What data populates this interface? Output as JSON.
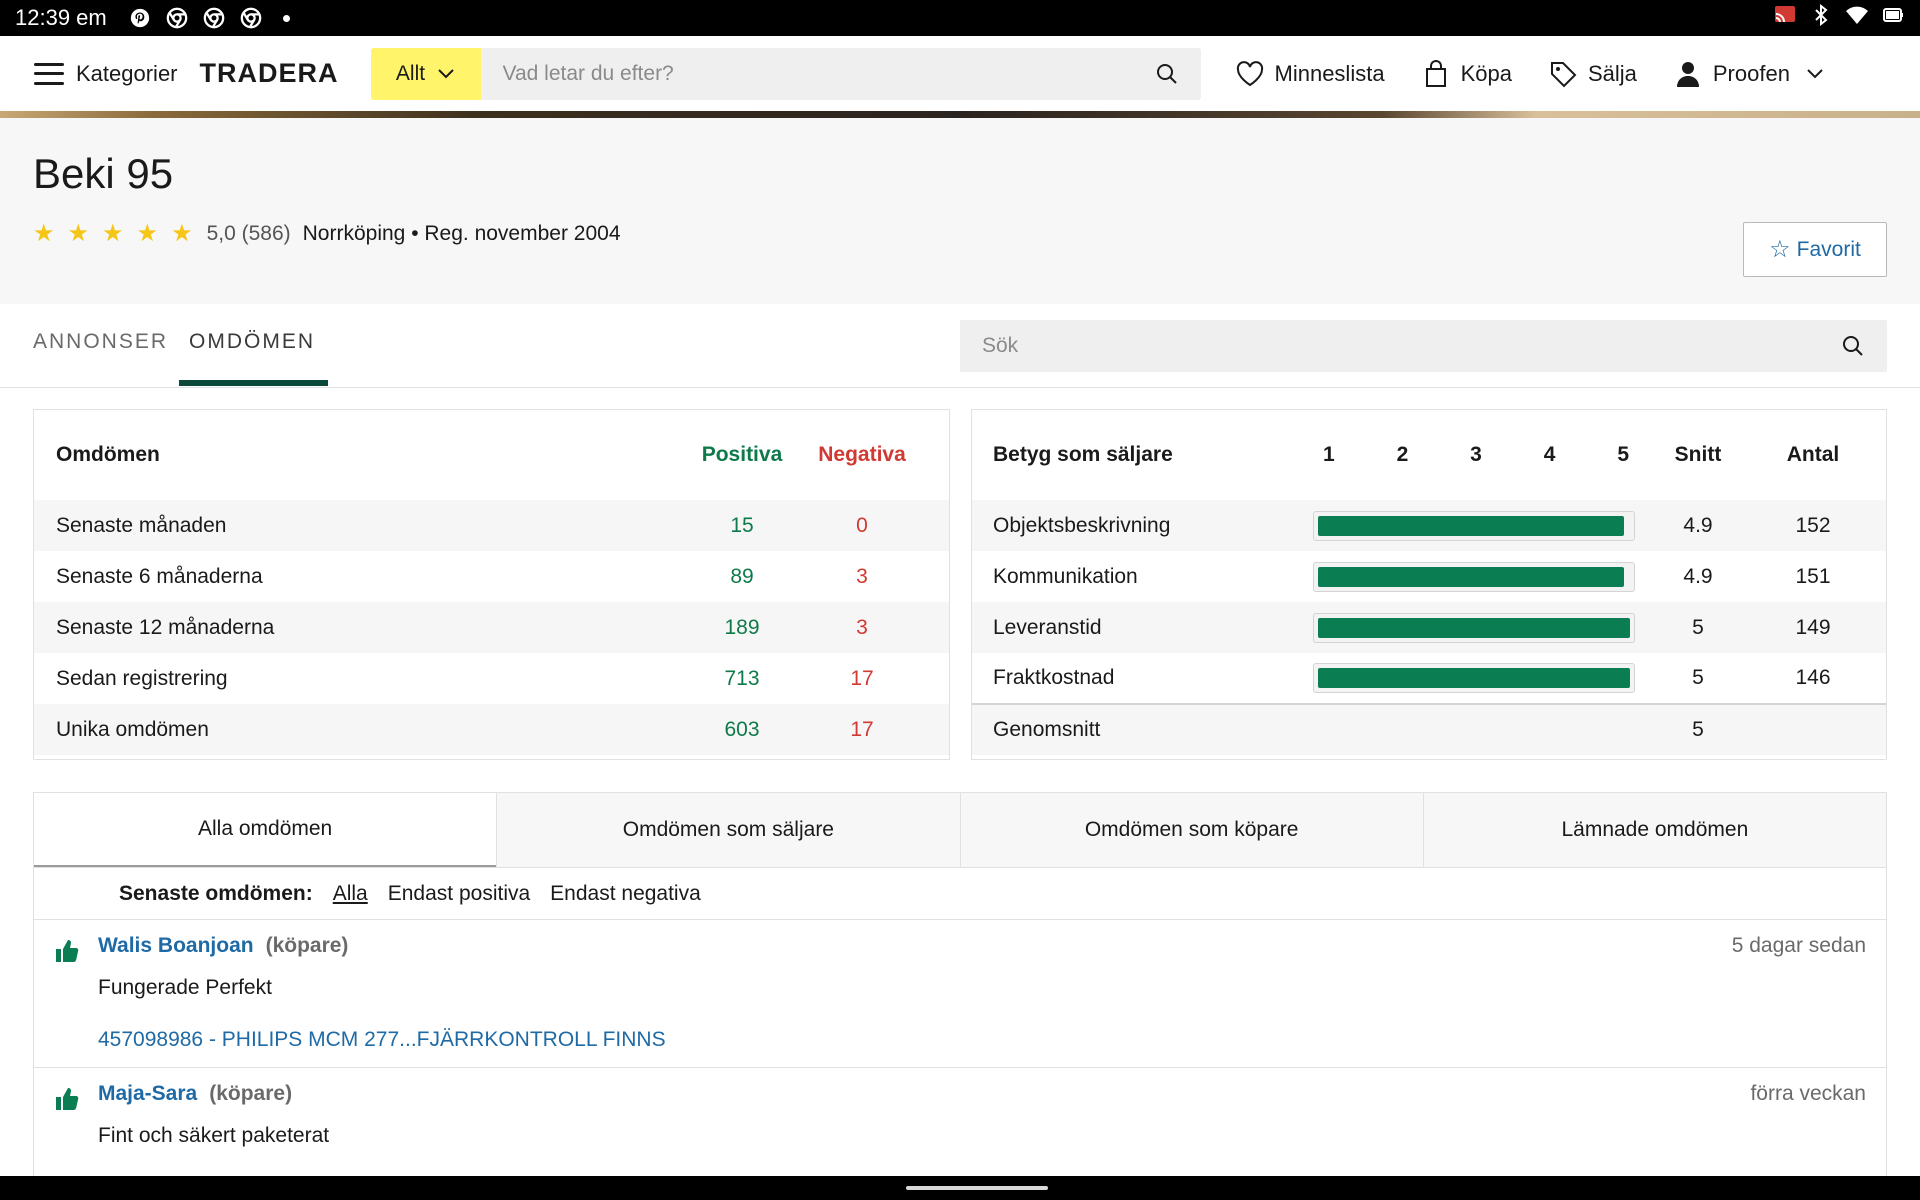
{
  "status_bar": {
    "time": "12:39 em",
    "app_icons": [
      "pinterest-icon",
      "chrome-icon",
      "chrome-icon",
      "chrome-icon"
    ],
    "right_icons": [
      "cast-icon",
      "bluetooth-icon",
      "wifi-icon",
      "battery-icon"
    ]
  },
  "topnav": {
    "menu_label": "Kategorier",
    "logo": "TRADERA",
    "category_select": "Allt",
    "search_placeholder": "Vad letar du efter?",
    "links": {
      "wishlist": "Minneslista",
      "buy": "Köpa",
      "sell": "Sälja",
      "account": "Proofen"
    }
  },
  "profile": {
    "name": "Beki 95",
    "rating": "5,0 (586)",
    "location_reg": "Norrköping • Reg. november 2004",
    "favorite_label": "Favorit",
    "stars": 5
  },
  "tabs": {
    "ads": "ANNONSER",
    "reviews": "OMDÖMEN",
    "search_placeholder": "Sök"
  },
  "feedback_summary": {
    "header": "Omdömen",
    "positive_header": "Positiva",
    "negative_header": "Negativa",
    "rows": [
      {
        "label": "Senaste månaden",
        "positive": "15",
        "negative": "0"
      },
      {
        "label": "Senaste 6 månaderna",
        "positive": "89",
        "negative": "3"
      },
      {
        "label": "Senaste 12 månaderna",
        "positive": "189",
        "negative": "3"
      },
      {
        "label": "Sedan registrering",
        "positive": "713",
        "negative": "17"
      },
      {
        "label": "Unika omdömen",
        "positive": "603",
        "negative": "17"
      }
    ]
  },
  "seller_ratings": {
    "header": "Betyg som säljare",
    "scale": [
      "1",
      "2",
      "3",
      "4",
      "5"
    ],
    "avg_header": "Snitt",
    "count_header": "Antal",
    "rows": [
      {
        "label": "Objektsbeskrivning",
        "avg": "4.9",
        "count": "152",
        "level": 0.98
      },
      {
        "label": "Kommunikation",
        "avg": "4.9",
        "count": "151",
        "level": 0.98
      },
      {
        "label": "Leveranstid",
        "avg": "5",
        "count": "149",
        "level": 1.0
      },
      {
        "label": "Fraktkostnad",
        "avg": "5",
        "count": "146",
        "level": 1.0
      }
    ],
    "overall_label": "Genomsnitt",
    "overall_avg": "5"
  },
  "review_tabs": [
    "Alla omdömen",
    "Omdömen som säljare",
    "Omdömen som köpare",
    "Lämnade omdömen"
  ],
  "filter": {
    "label": "Senaste omdömen:",
    "options": [
      "Alla",
      "Endast positiva",
      "Endast negativa"
    ]
  },
  "reviews": [
    {
      "name": "Walis Boanjoan",
      "role": "(köpare)",
      "time": "5 dagar sedan",
      "text": "Fungerade Perfekt",
      "link": "457098986 - PHILIPS MCM 277...FJÄRRKONTROLL FINNS"
    },
    {
      "name": "Maja-Sara",
      "role": "(köpare)",
      "time": "förra veckan",
      "text": "Fint och säkert paketerat"
    }
  ],
  "colors": {
    "positive": "#0e7a4a",
    "negative": "#d13a32",
    "link": "#1f6aa5",
    "category_yellow": "#fff46a",
    "bar_fill": "#0b7d52",
    "tab_underline": "#0b4a3a"
  }
}
